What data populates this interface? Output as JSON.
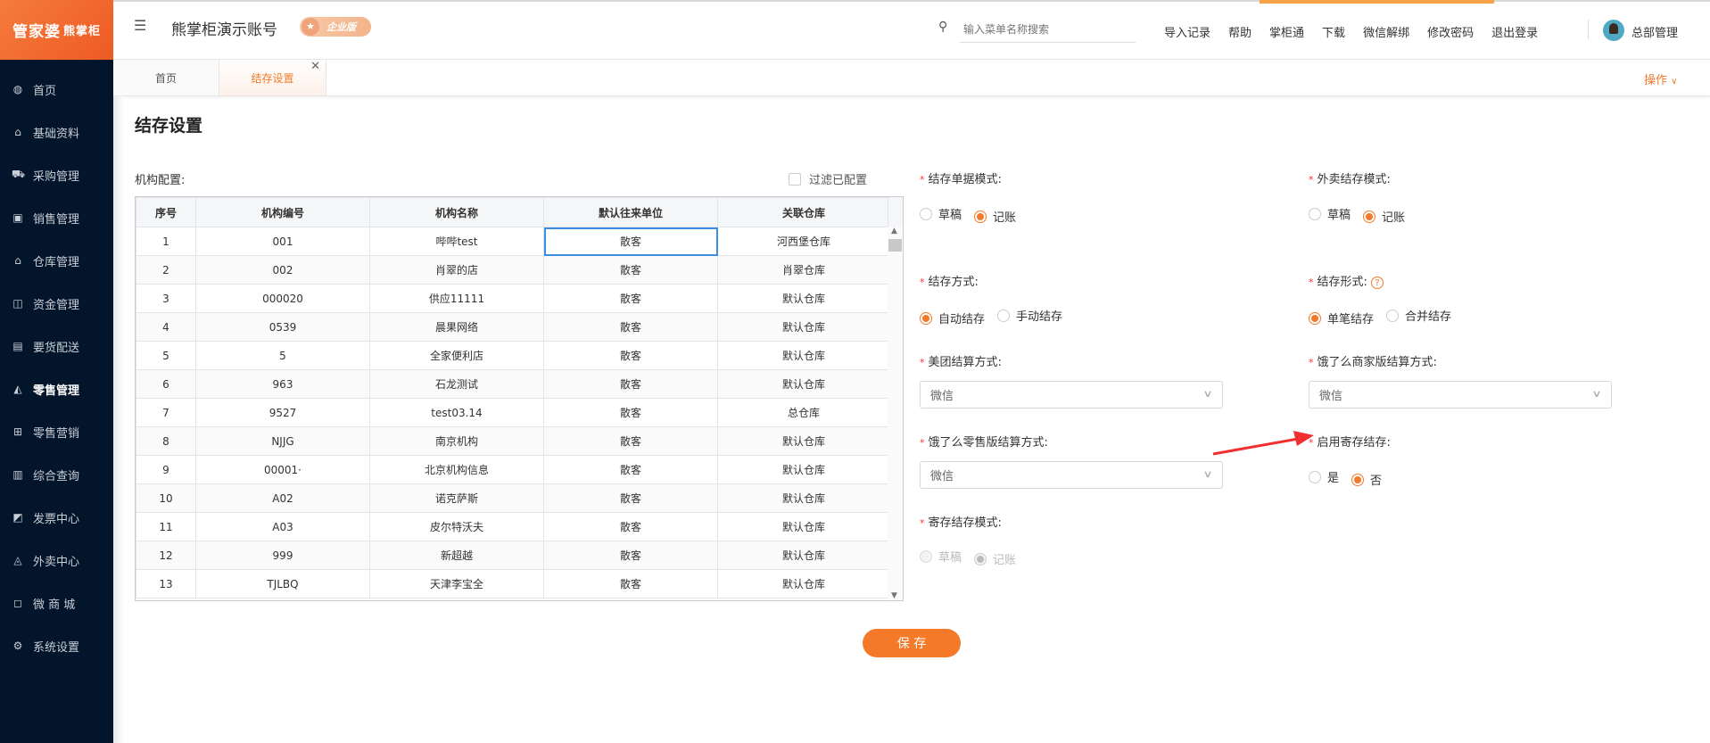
{
  "brand": {
    "logo_main": "管家婆",
    "logo_sub": "熊掌柜"
  },
  "sidebar": {
    "items": [
      {
        "label": "首页",
        "icon": "globe-icon",
        "glyph": "◍"
      },
      {
        "label": "基础资料",
        "icon": "home-icon",
        "glyph": "⌂"
      },
      {
        "label": "采购管理",
        "icon": "cart-icon",
        "glyph": "⛟"
      },
      {
        "label": "销售管理",
        "icon": "calendar-icon",
        "glyph": "▣"
      },
      {
        "label": "仓库管理",
        "icon": "bank-icon",
        "glyph": "⌂"
      },
      {
        "label": "资金管理",
        "icon": "money-icon",
        "glyph": "◫"
      },
      {
        "label": "要货配送",
        "icon": "list-icon",
        "glyph": "▤"
      },
      {
        "label": "零售管理",
        "icon": "area-chart-icon",
        "glyph": "◭"
      },
      {
        "label": "零售营销",
        "icon": "gift-icon",
        "glyph": "⊞"
      },
      {
        "label": "综合查询",
        "icon": "bar-chart-icon",
        "glyph": "▥"
      },
      {
        "label": "发票中心",
        "icon": "line-chart-icon",
        "glyph": "◩"
      },
      {
        "label": "外卖中心",
        "icon": "bell-icon",
        "glyph": "◬"
      },
      {
        "label": "微 商 城",
        "icon": "bag-icon",
        "glyph": "◻"
      },
      {
        "label": "系统设置",
        "icon": "gear-icon",
        "glyph": "⚙"
      }
    ],
    "active": "零售管理"
  },
  "header": {
    "account": "熊掌柜演示账号",
    "edition_badge": "企业版",
    "search_placeholder": "输入菜单名称搜索",
    "links": [
      "导入记录",
      "帮助",
      "掌柜通",
      "下载",
      "微信解绑",
      "修改密码",
      "退出登录"
    ],
    "user": "总部管理"
  },
  "tabs": {
    "items": [
      "首页",
      "结存设置"
    ],
    "active": "结存设置",
    "operate": "操作"
  },
  "page": {
    "title": "结存设置",
    "org_label": "机构配置:",
    "filter_label": "过滤已配置",
    "filter_checked": false,
    "save": "保 存"
  },
  "table": {
    "columns": [
      "序号",
      "机构编号",
      "机构名称",
      "默认往来单位",
      "关联仓库"
    ],
    "rows": [
      [
        "1",
        "001",
        "哔哔test",
        "散客",
        "河西堡仓库"
      ],
      [
        "2",
        "002",
        "肖翠的店",
        "散客",
        "肖翠仓库"
      ],
      [
        "3",
        "000020",
        "供应11111",
        "散客",
        "默认仓库"
      ],
      [
        "4",
        "0539",
        "晨果网络",
        "散客",
        "默认仓库"
      ],
      [
        "5",
        "5",
        "全家便利店",
        "散客",
        "默认仓库"
      ],
      [
        "6",
        "963",
        "石龙测试",
        "散客",
        "默认仓库"
      ],
      [
        "7",
        "9527",
        "test03.14",
        "散客",
        "总仓库"
      ],
      [
        "8",
        "NJJG",
        "南京机构",
        "散客",
        "默认仓库"
      ],
      [
        "9",
        "00001·",
        "北京机构信息",
        "散客",
        "默认仓库"
      ],
      [
        "10",
        "A02",
        "诺克萨斯",
        "散客",
        "默认仓库"
      ],
      [
        "11",
        "A03",
        "皮尔特沃夫",
        "散客",
        "默认仓库"
      ],
      [
        "12",
        "999",
        "新超越",
        "散客",
        "默认仓库"
      ],
      [
        "13",
        "TJLBQ",
        "天津李宝全",
        "散客",
        "默认仓库"
      ]
    ]
  },
  "form": {
    "doc_mode": {
      "label": "结存单据模式:",
      "options": [
        "草稿",
        "记账"
      ],
      "selected": "记账"
    },
    "takeout_mode": {
      "label": "外卖结存模式:",
      "options": [
        "草稿",
        "记账"
      ],
      "selected": "记账"
    },
    "method": {
      "label": "结存方式:",
      "options": [
        "自动结存",
        "手动结存"
      ],
      "selected": "自动结存"
    },
    "form_type": {
      "label": "结存形式:",
      "options": [
        "单笔结存",
        "合并结存"
      ],
      "selected": "单笔结存",
      "help": "?"
    },
    "meituan": {
      "label": "美团结算方式:",
      "value": "微信"
    },
    "eleme_merchant": {
      "label": "饿了么商家版结算方式:",
      "value": "微信"
    },
    "eleme_retail": {
      "label": "饿了么零售版结算方式:",
      "value": "微信"
    },
    "consign_enable": {
      "label": "启用寄存结存:",
      "options": [
        "是",
        "否"
      ],
      "selected": "否"
    },
    "consign_mode": {
      "label": "寄存结存模式:",
      "options": [
        "草稿",
        "记账"
      ],
      "selected": "记账",
      "disabled": true
    }
  },
  "colors": {
    "accent": "#f47a2a",
    "sidebar": "#03152b",
    "arrow": "#f03030"
  }
}
